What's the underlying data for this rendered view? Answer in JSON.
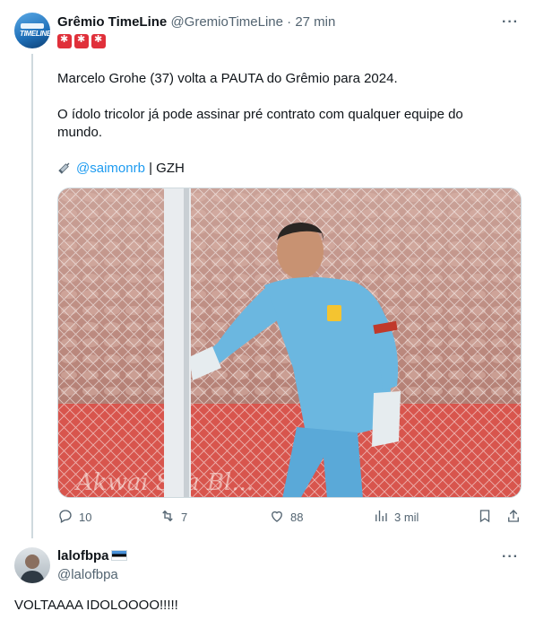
{
  "tweet": {
    "author_name": "Grêmio TimeLine",
    "author_handle": "@GremioTimeLine",
    "separator": "·",
    "time": "27 min",
    "avatar_text": "TIMELINE",
    "lines": [
      "Marcelo Grohe (37) volta a PAUTA do Grêmio para 2024.",
      "O ídolo tricolor já pode assinar pré contrato com qualquer equipe do",
      "mundo."
    ],
    "credit_mention": "@saimonrb",
    "credit_suffix": " | GZH",
    "media_alt": "Goalkeeper in light-blue kit pointing during a match",
    "stats": {
      "replies": "10",
      "retweets": "7",
      "likes": "88",
      "views": "3 mil"
    }
  },
  "reply": {
    "author_name": "lalofbpa",
    "author_handle": "@lalofbpa",
    "text": "VOLTAAAA IDOLOOOO!!!!!"
  },
  "colors": {
    "accent": "#1d9bf0",
    "muted": "#536471",
    "text": "#0f1419"
  }
}
